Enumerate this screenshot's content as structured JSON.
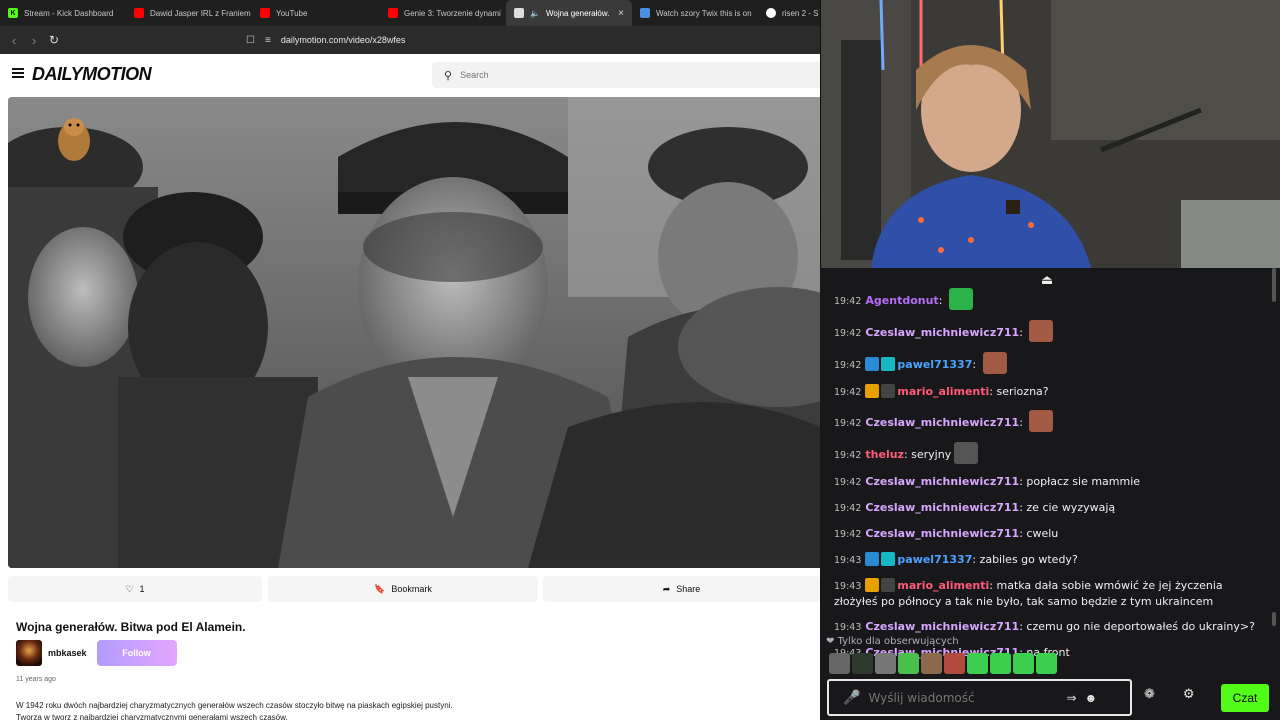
{
  "browser": {
    "tabs": [
      {
        "label": "Stream - Kick Dashboard",
        "icon": "kick-icon",
        "color": "#53fc18"
      },
      {
        "label": "Dawid Jasper IRL z Franiem",
        "icon": "youtube-icon",
        "color": "#ff0000"
      },
      {
        "label": "YouTube",
        "icon": "youtube-icon",
        "color": "#ff0000"
      },
      {
        "label": "Genie 3: Tworzenie dynami",
        "icon": "youtube-icon",
        "color": "#ff0000"
      },
      {
        "label": "Wojna generałów.",
        "icon": "dailymotion-icon",
        "color": "#ffffff",
        "active": true
      },
      {
        "label": "Watch szory Twix this is on",
        "icon": "globe-icon",
        "color": "#4a90e2"
      },
      {
        "label": "risen 2 - S",
        "icon": "google-icon",
        "color": "#ffffff"
      }
    ],
    "url": "dailymotion.com/video/x28wfes"
  },
  "dailymotion": {
    "logo": "DAILYMOTION",
    "search_placeholder": "Search",
    "likes": "1",
    "bookmark_label": "Bookmark",
    "share_label": "Share",
    "video_title": "Wojna generałów. Bitwa pod El Alamein.",
    "channel_name": "mbkasek",
    "follow_label": "Follow",
    "upload_age": "11 years ago",
    "description_line1": "W 1942 roku dwóch najbardziej charyzmatycznych generałów wszech czasów stoczyło bitwę na piaskach egipskiej pustyni.",
    "description_line2": "Tworzą w tworz z najbardziej charyzmatycznymi generałami wszech czasów."
  },
  "chat": {
    "messages": [
      {
        "time": "19:42",
        "user": "Agentdonut",
        "color": "#b66cf5",
        "text": "",
        "badges": [],
        "emote": "#2bb34a"
      },
      {
        "time": "19:42",
        "user": "Czeslaw_michniewicz711",
        "color": "#d9a6ff",
        "text": "",
        "badges": [],
        "emote": "#a15a44"
      },
      {
        "time": "19:42",
        "user": "pawel71337",
        "color": "#4aa3ff",
        "text": "",
        "badges": [
          "#2a8ad4",
          "#17b8c6"
        ],
        "emote": "#a15a44"
      },
      {
        "time": "19:42",
        "user": "mario_alimenti",
        "color": "#ff5a78",
        "text": "seriozna?",
        "badges": [
          "#e8a000",
          "#444"
        ],
        "emote": ""
      },
      {
        "time": "19:42",
        "user": "Czeslaw_michniewicz711",
        "color": "#d9a6ff",
        "text": "",
        "badges": [],
        "emote": "#a15a44"
      },
      {
        "time": "19:42",
        "user": "theluz",
        "color": "#ff5a78",
        "text": "seryjny",
        "badges": [],
        "emote": "#555555"
      },
      {
        "time": "19:42",
        "user": "Czeslaw_michniewicz711",
        "color": "#d9a6ff",
        "text": "popłacz sie mammie",
        "badges": [],
        "emote": ""
      },
      {
        "time": "19:42",
        "user": "Czeslaw_michniewicz711",
        "color": "#d9a6ff",
        "text": "ze cie wyzywają",
        "badges": [],
        "emote": ""
      },
      {
        "time": "19:42",
        "user": "Czeslaw_michniewicz711",
        "color": "#d9a6ff",
        "text": "cwelu",
        "badges": [],
        "emote": ""
      },
      {
        "time": "19:43",
        "user": "pawel71337",
        "color": "#4aa3ff",
        "text": "zabiles go wtedy?",
        "badges": [
          "#2a8ad4",
          "#17b8c6"
        ],
        "emote": ""
      },
      {
        "time": "19:43",
        "user": "mario_alimenti",
        "color": "#ff5a78",
        "text": "matka dała sobie wmówić że jej życzenia złożyłeś po północy a tak nie było, tak samo będzie z tym ukraincem",
        "badges": [
          "#e8a000",
          "#444"
        ],
        "emote": ""
      },
      {
        "time": "19:43",
        "user": "Czeslaw_michniewicz711",
        "color": "#d9a6ff",
        "text": "czemu go nie deportowałeś do ukrainy>?",
        "badges": [],
        "emote": ""
      },
      {
        "time": "19:43",
        "user": "Czeslaw_michniewicz711",
        "color": "#d9a6ff",
        "text": "na front",
        "badges": [],
        "emote": ""
      }
    ],
    "followers_only_label": "Tylko dla obserwujących",
    "input_placeholder": "Wyślij wiadomość",
    "send_label": "Czat",
    "quick_emotes": [
      "#666",
      "#2f3a2f",
      "#777",
      "#4bbf4b",
      "#8a6a4a",
      "#b04a3a",
      "#3ccf4e",
      "#3ccf4e",
      "#3ccf4e",
      "#3ccf4e"
    ]
  }
}
